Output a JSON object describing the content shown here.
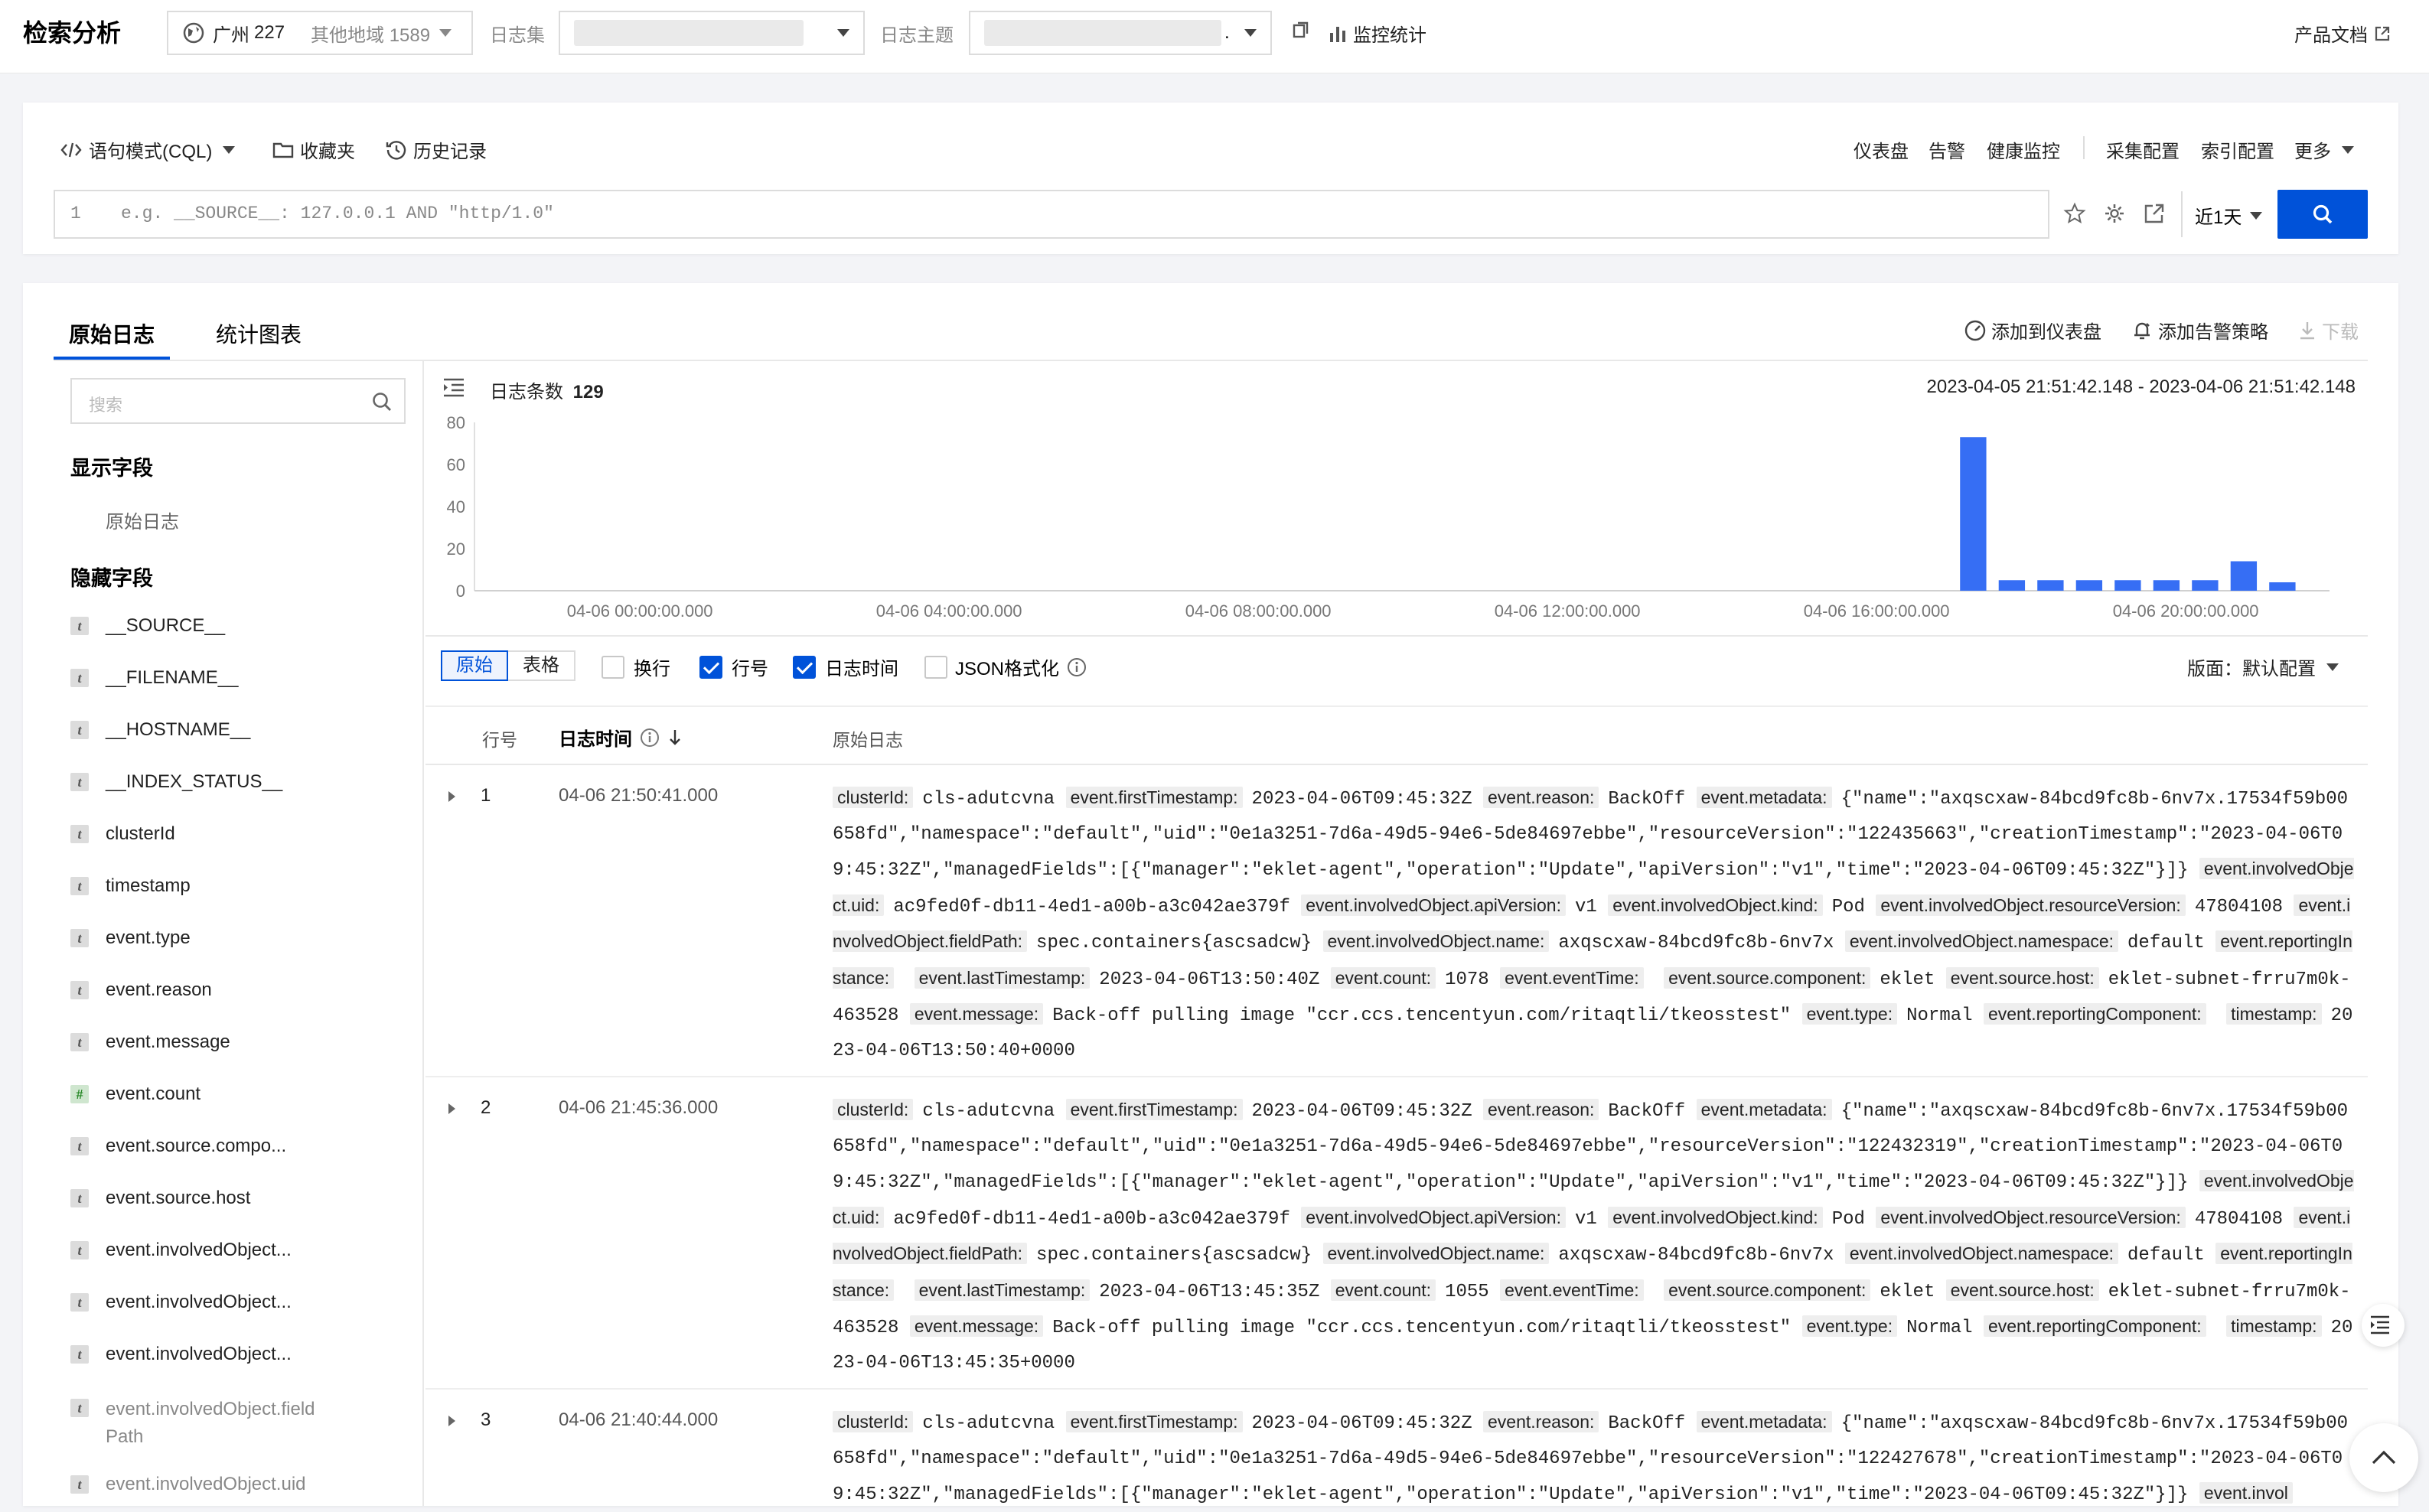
{
  "header": {
    "title": "检索分析",
    "region_name": "广州",
    "region_count": "227",
    "other_region": "其他地域 1589",
    "logset_label": "日志集",
    "topic_label": "日志主题",
    "topic_suffix": ".",
    "monitor_label": "监控统计",
    "docs_label": "产品文档"
  },
  "query": {
    "mode_label": "语句模式(CQL)",
    "favorites_label": "收藏夹",
    "history_label": "历史记录",
    "links": [
      "仪表盘",
      "告警",
      "健康监控",
      "采集配置",
      "索引配置",
      "更多"
    ],
    "line_no": "1",
    "placeholder": "e.g. __SOURCE__: 127.0.0.1 AND \"http/1.0\"",
    "time_range": "近1天"
  },
  "tabs": {
    "raw": "原始日志",
    "chart": "统计图表"
  },
  "actions": {
    "add_dashboard": "添加到仪表盘",
    "add_alarm": "添加告警策略",
    "download": "下载"
  },
  "sidebar": {
    "search_placeholder": "搜索",
    "shown_title": "显示字段",
    "shown_fields": [
      "原始日志"
    ],
    "hidden_title": "隐藏字段",
    "hidden_fields": [
      {
        "type": "t",
        "name": "__SOURCE__"
      },
      {
        "type": "t",
        "name": "__FILENAME__"
      },
      {
        "type": "t",
        "name": "__HOSTNAME__"
      },
      {
        "type": "t",
        "name": "__INDEX_STATUS__"
      },
      {
        "type": "t",
        "name": "clusterId"
      },
      {
        "type": "t",
        "name": "timestamp"
      },
      {
        "type": "t",
        "name": "event.type"
      },
      {
        "type": "t",
        "name": "event.reason"
      },
      {
        "type": "t",
        "name": "event.message"
      },
      {
        "type": "#",
        "name": "event.count"
      },
      {
        "type": "t",
        "name": "event.source.compo..."
      },
      {
        "type": "t",
        "name": "event.source.host"
      },
      {
        "type": "t",
        "name": "event.involvedObject..."
      },
      {
        "type": "t",
        "name": "event.involvedObject..."
      },
      {
        "type": "t",
        "name": "event.involvedObject..."
      },
      {
        "type": "t",
        "name": "event.involvedObject.field Path"
      },
      {
        "type": "t",
        "name": "event.involvedObject.uid"
      }
    ]
  },
  "histogram": {
    "count_label": "日志条数",
    "count_value": "129",
    "range_text": "2023-04-05 21:51:42.148 - 2023-04-06 21:51:42.148"
  },
  "chart_data": {
    "type": "bar",
    "ylim": [
      0,
      80
    ],
    "yticks": [
      0,
      20,
      40,
      60,
      80
    ],
    "xticks": [
      "04-06 00:00:00.000",
      "04-06 04:00:00.000",
      "04-06 08:00:00.000",
      "04-06 12:00:00.000",
      "04-06 16:00:00.000",
      "04-06 20:00:00.000"
    ],
    "x_range_hours": [
      -2.14,
      21.86
    ],
    "bucket_hours": 0.5,
    "bars": [
      {
        "start_hours": 17.0,
        "value": 73
      },
      {
        "start_hours": 17.5,
        "value": 5
      },
      {
        "start_hours": 18.0,
        "value": 5
      },
      {
        "start_hours": 18.5,
        "value": 5
      },
      {
        "start_hours": 19.0,
        "value": 5
      },
      {
        "start_hours": 19.5,
        "value": 5
      },
      {
        "start_hours": 20.0,
        "value": 5
      },
      {
        "start_hours": 20.5,
        "value": 14
      },
      {
        "start_hours": 21.0,
        "value": 4
      }
    ],
    "color": "#366ef4"
  },
  "viewbar": {
    "raw_label": "原始",
    "table_label": "表格",
    "wrap_label": "换行",
    "lineno_label": "行号",
    "logtime_label": "日志时间",
    "json_label": "JSON格式化",
    "layout_label": "版面：默认配置"
  },
  "table_header": {
    "lineno": "行号",
    "time": "日志时间",
    "log": "原始日志"
  },
  "logs": [
    {
      "num": "1",
      "time": "04-06 21:50:41.000",
      "reason": "BackOff",
      "rv_meta": "122435663",
      "last_ts": "2023-04-06T13:50:40Z",
      "count": "1078",
      "timestamp": "2023-04-06T13:50:40+0000"
    },
    {
      "num": "2",
      "time": "04-06 21:45:36.000",
      "reason": "BackOff",
      "rv_meta": "122432319",
      "last_ts": "2023-04-06T13:45:35Z",
      "count": "1055",
      "timestamp": "2023-04-06T13:45:35+0000"
    },
    {
      "num": "3",
      "time": "04-06 21:40:44.000",
      "reason": "BackOff",
      "rv_meta": "122427678",
      "last_ts": "",
      "count": "",
      "timestamp": ""
    }
  ],
  "log_common": {
    "cluster": "cls-adutcvna",
    "first_ts": "2023-04-06T09:45:32Z",
    "meta_name": "axqscxaw-84bcd9fc8b-6nv7x.17534f59b00658fd",
    "uid": "0e1a3251-7d6a-49d5-94e6-5de84697ebbe",
    "obj_uid": "ac9fed0f-db11-4ed1-a00b-a3c042ae379f",
    "api_version": "v1",
    "kind": "Pod",
    "resource_version": "47804108",
    "field_path": "spec.containers{ascsadcw}",
    "obj_name": "axqscxaw-84bcd9fc8b-6nv7x",
    "namespace": "default",
    "component": "eklet",
    "host": "eklet-subnet-frru7m0k-463528",
    "message": "Back-off pulling image \"ccr.ccs.tencentyun.com/ritaqtli/tkeosstest\"",
    "type": "Normal"
  }
}
